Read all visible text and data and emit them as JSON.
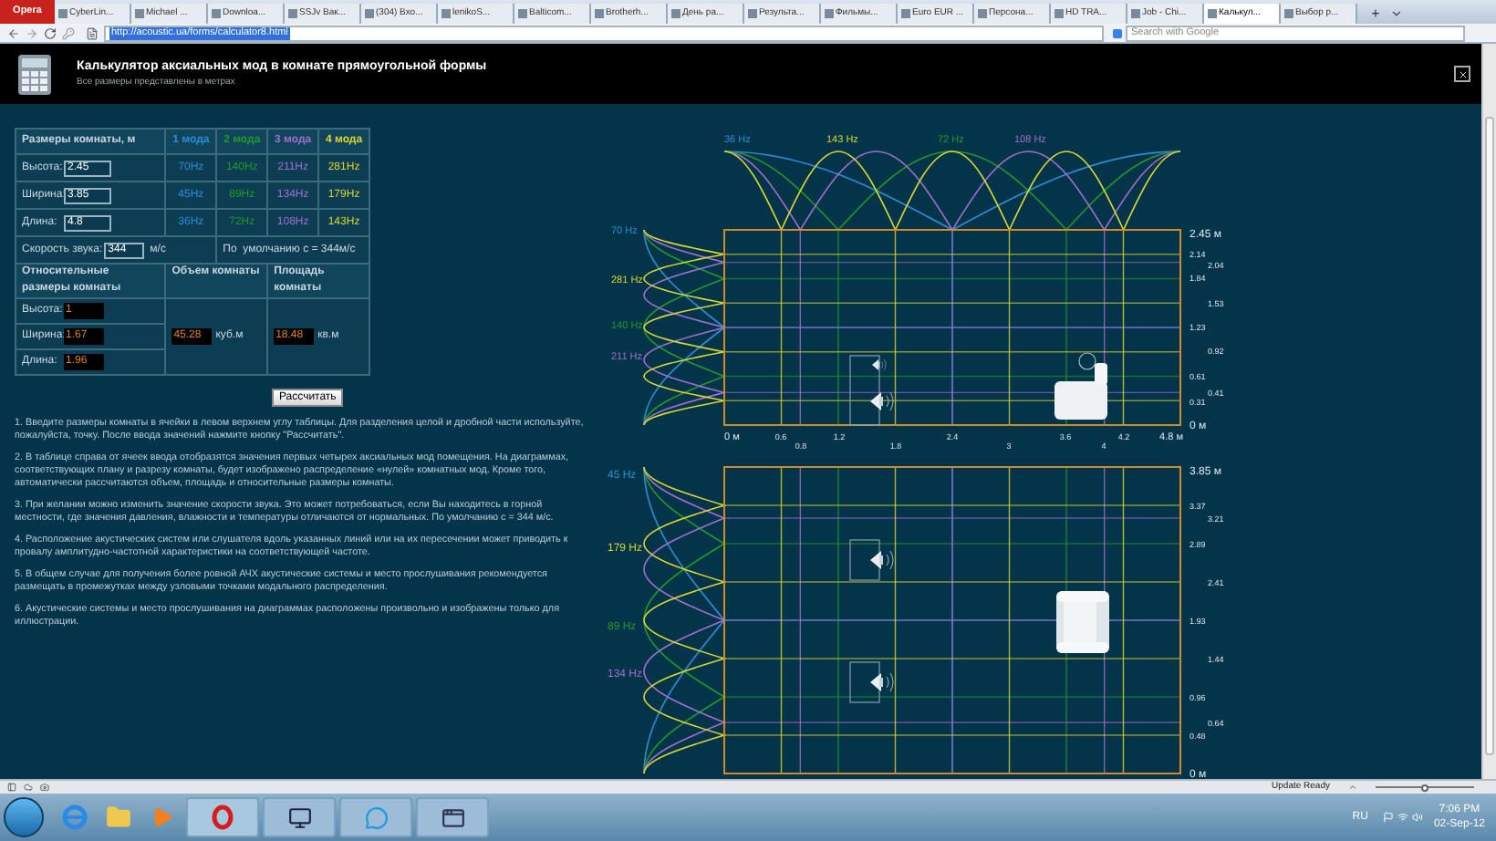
{
  "browser": {
    "menu_label": "Opera",
    "tabs": [
      {
        "label": "CyberLin...",
        "selected": false
      },
      {
        "label": "Michael ...",
        "selected": false
      },
      {
        "label": "Downloa...",
        "selected": false
      },
      {
        "label": "SSJv Вак...",
        "selected": false
      },
      {
        "label": "(304) Вхо...",
        "selected": false
      },
      {
        "label": "lenikoS...",
        "selected": false
      },
      {
        "label": "Balticom...",
        "selected": false
      },
      {
        "label": "Brotherh...",
        "selected": false
      },
      {
        "label": "День ра...",
        "selected": false
      },
      {
        "label": "Результа...",
        "selected": false
      },
      {
        "label": "Фильмы...",
        "selected": false
      },
      {
        "label": "Euro EUR ...",
        "selected": false
      },
      {
        "label": "Персона...",
        "selected": false
      },
      {
        "label": "HD TRA...",
        "selected": false
      },
      {
        "label": "Job - Chi...",
        "selected": false
      },
      {
        "label": "Калькул...",
        "selected": true
      },
      {
        "label": "Выбор р...",
        "selected": false
      }
    ],
    "new_tab": "+",
    "address": "http://acoustic.ua/forms/calculator8.html",
    "search_placeholder": "Search with Google"
  },
  "header": {
    "title": "Калькулятор аксиальных мод в комнате прямоугольной формы",
    "subtitle": "Все размеры представлены в метрах"
  },
  "table": {
    "dims_heading": "Размеры комнаты, м",
    "modes": [
      {
        "label": "1 мода",
        "color": "#2a8fd6"
      },
      {
        "label": "2 мода",
        "color": "#1f9a2a"
      },
      {
        "label": "3 мода",
        "color": "#a070d0"
      },
      {
        "label": "4 мода",
        "color": "#d8d830"
      }
    ],
    "rows": [
      {
        "label": "Высота:",
        "value": "2.45",
        "freqs": [
          "70Hz",
          "140Hz",
          "211Hz",
          "281Hz"
        ]
      },
      {
        "label": "Ширина:",
        "value": "3.85",
        "freqs": [
          "45Hz",
          "89Hz",
          "134Hz",
          "179Hz"
        ]
      },
      {
        "label": "Длина:",
        "value": "4.8",
        "freqs": [
          "36Hz",
          "72Hz",
          "108Hz",
          "143Hz"
        ]
      }
    ],
    "speed_label": "Скорость звука:",
    "speed_value": "344",
    "speed_unit": "м/с",
    "default_note": "По  умолчанию с = 344м/с",
    "relative_heading": "Относительные размеры комнаты",
    "volume_heading": "Объем комнаты",
    "area_heading": "Площадь комнаты",
    "relative_rows": [
      {
        "label": "Высота:",
        "value": "1"
      },
      {
        "label": "Ширина:",
        "value": "1.67"
      },
      {
        "label": "Длина:",
        "value": "1.96"
      }
    ],
    "volume_value": "45.28",
    "volume_unit": "куб.м",
    "area_value": "18.48",
    "area_unit": "кв.м"
  },
  "calculate_button": "Рассчитать",
  "instructions": [
    "1. Введите размеры комнаты в ячейки в левом верхнем углу таблицы. Для разделения целой и дробной части используйте, пожалуйста, точку. После ввода значений нажмите кнопку \"Рассчитать\".",
    "2. В таблице справа от ячеек ввода отобразятся значения первых четырех аксиальных мод помещения. На диаграммах, соответствующих плану и разрезу комнаты, будет изображено распределение «нулей» комнатных мод. Кроме того, автоматически рассчитаются объем, площадь и относительные размеры комнаты.",
    "3. При желании можно изменить значение скорости звука. Это может потребоваться, если Вы находитесь в горной местности, где значения давления, влажности и температуры отличаются от нормальных. По умолчанию c = 344 м/с.",
    "4. Расположение акустических систем или слушателя вдоль указанных линий или на их пересечении может приводить к провалу амплитудно-частотной характеристики на соответствующей частоте.",
    "5. В общем случае для получения более ровной АЧХ акустические системы и место прослушивания рекомендуется размещать в промежутках между узловыми точками модального распределения.",
    "6. Акустические системы и место прослушивания на диаграммах расположены произвольно и изображены только для иллюстрации."
  ],
  "section_diagram": {
    "top_labels": [
      {
        "text": "36 Hz",
        "color": "#2a8fd6"
      },
      {
        "text": "143 Hz",
        "color": "#d8d830"
      },
      {
        "text": "72 Hz",
        "color": "#1f9a2a"
      },
      {
        "text": "108 Hz",
        "color": "#a070d0"
      }
    ],
    "left_labels": [
      {
        "text": "70 Hz",
        "color": "#2a8fd6"
      },
      {
        "text": "281 Hz",
        "color": "#d8d830"
      },
      {
        "text": "140 Hz",
        "color": "#1f9a2a"
      },
      {
        "text": "211 Hz",
        "color": "#a070d0"
      }
    ],
    "right_ticks": [
      "2.45 м",
      "2.14",
      "2.04",
      "1.84",
      "1.53",
      "1.23",
      "0.92",
      "0.61",
      "0.41",
      "0.31",
      "0 м"
    ],
    "bottom_ticks": [
      "0 м",
      "0.6",
      "0.8",
      "1.2",
      "1.8",
      "2.4",
      "3",
      "3.6",
      "4",
      "4.2",
      "4.8 м"
    ]
  },
  "plan_diagram": {
    "left_labels": [
      {
        "text": "45 Hz",
        "color": "#2a8fd6"
      },
      {
        "text": "179 Hz",
        "color": "#d8d830"
      },
      {
        "text": "89 Hz",
        "color": "#1f9a2a"
      },
      {
        "text": "134 Hz",
        "color": "#a070d0"
      }
    ],
    "right_ticks": [
      "3.85 м",
      "3.37",
      "3.21",
      "2.89",
      "2.41",
      "1.93",
      "1.44",
      "0.96",
      "0.64",
      "0.48",
      "0 м"
    ]
  },
  "status_bar": {
    "update": "Update Ready",
    "zoom": {
      "level": 0.5
    }
  },
  "taskbar": {
    "language": "RU",
    "time": "7:06 PM",
    "date": "02-Sep-12"
  }
}
